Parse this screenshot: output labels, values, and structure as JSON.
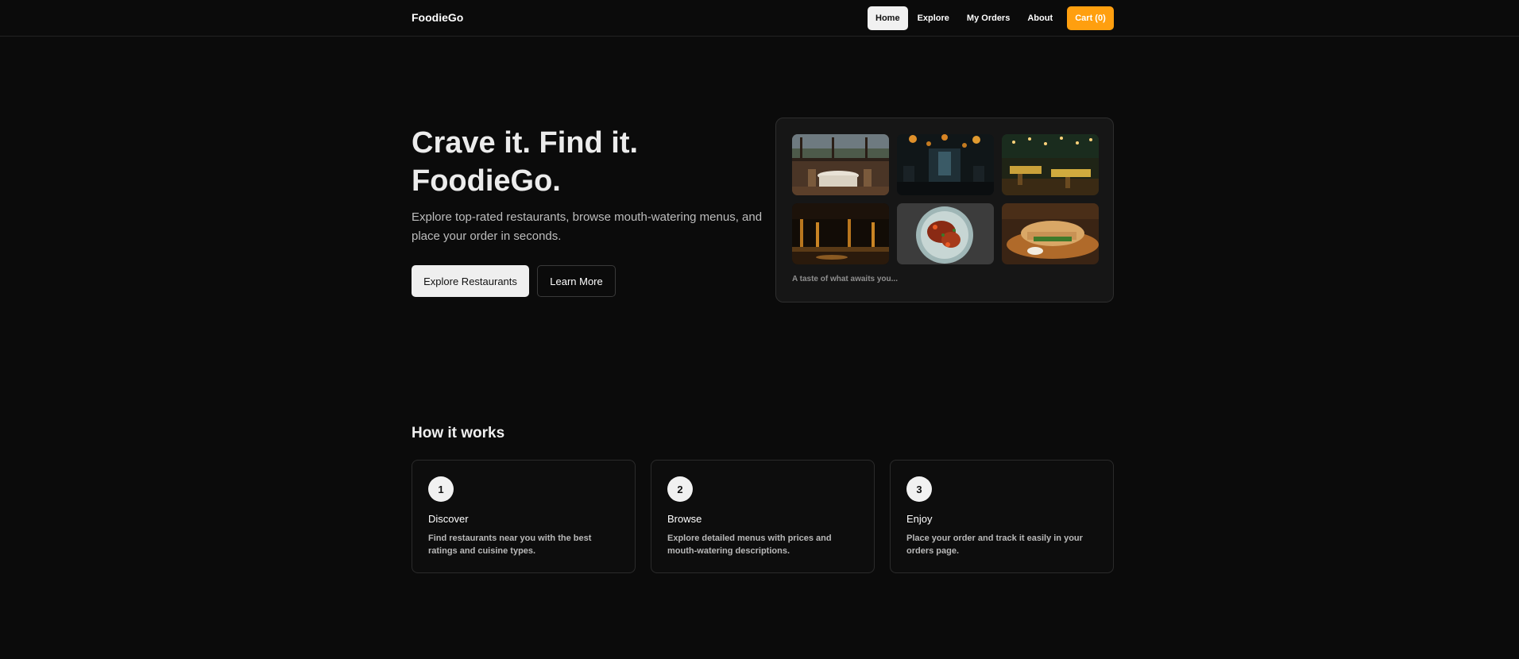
{
  "header": {
    "brand": "FoodieGo",
    "nav": [
      {
        "label": "Home",
        "active": true
      },
      {
        "label": "Explore",
        "active": false
      },
      {
        "label": "My Orders",
        "active": false
      },
      {
        "label": "About",
        "active": false
      }
    ],
    "cart_label": "Cart (0)"
  },
  "hero": {
    "title_line1": "Crave it. Find it.",
    "title_line2": "FoodieGo.",
    "subtitle": "Explore top-rated restaurants, browse mouth-watering menus, and place your order in seconds.",
    "primary_button": "Explore Restaurants",
    "secondary_button": "Learn More"
  },
  "gallery": {
    "images": [
      "restaurant-window-view-image",
      "dim-bar-lanterns-image",
      "string-lights-dining-room-image",
      "night-lounge-bar-image",
      "grilled-dish-plate-image",
      "sandwich-board-image"
    ],
    "caption": "A taste of what awaits you..."
  },
  "how_it_works": {
    "title": "How it works",
    "steps": [
      {
        "number": "1",
        "title": "Discover",
        "desc": "Find restaurants near you with the best ratings and cuisine types."
      },
      {
        "number": "2",
        "title": "Browse",
        "desc": "Explore detailed menus with prices and mouth-watering descriptions."
      },
      {
        "number": "3",
        "title": "Enjoy",
        "desc": "Place your order and track it easily in your orders page."
      }
    ]
  },
  "colors": {
    "background": "#0b0b0b",
    "accent": "#ff9f0f",
    "card_border": "#2b2b2b"
  }
}
